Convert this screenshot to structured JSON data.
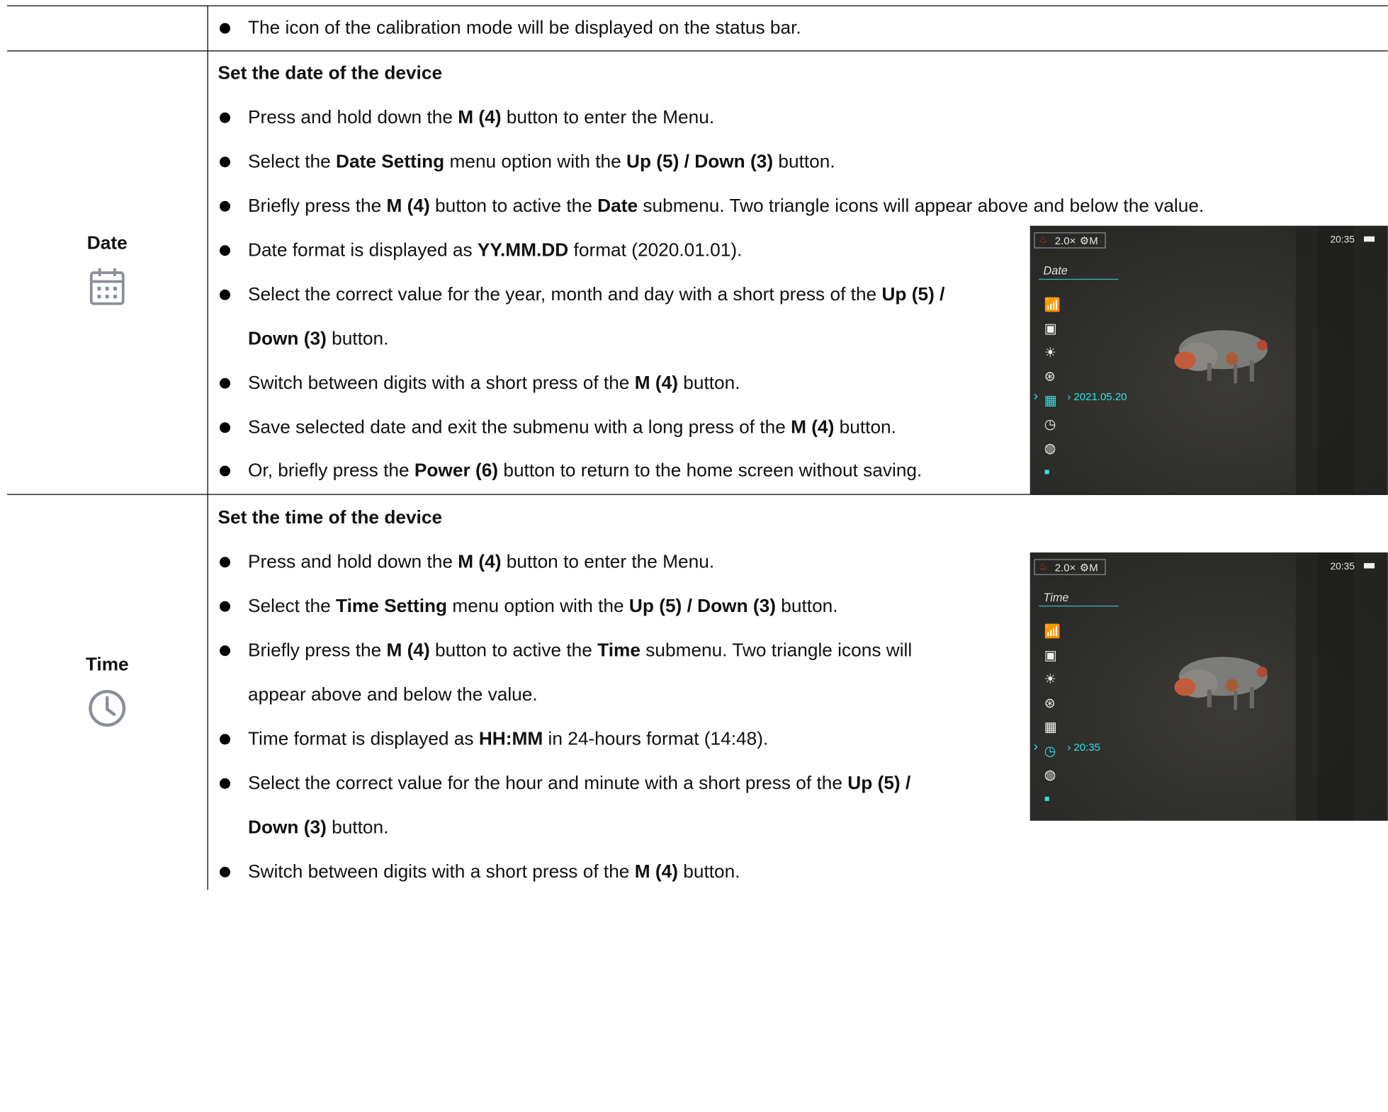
{
  "top_row": {
    "bullets": [
      [
        {
          "t": "The icon of the calibration mode will be displayed on the status bar."
        }
      ]
    ]
  },
  "date_row": {
    "label": "Date",
    "icon": "calendar-icon",
    "heading": "Set the date of the device",
    "bullets": [
      [
        {
          "t": "Press and hold down the "
        },
        {
          "t": "M (4)",
          "b": true
        },
        {
          "t": " button to enter the Menu."
        }
      ],
      [
        {
          "t": "Select the "
        },
        {
          "t": "Date Setting",
          "b": true
        },
        {
          "t": " menu option with the "
        },
        {
          "t": "Up (5) / Down (3)",
          "b": true
        },
        {
          "t": " button."
        }
      ],
      [
        {
          "t": "Briefly press the "
        },
        {
          "t": "M (4)",
          "b": true
        },
        {
          "t": " button to active the "
        },
        {
          "t": "Date",
          "b": true
        },
        {
          "t": " submenu. Two triangle icons will appear above and below the value."
        }
      ],
      [
        {
          "t": "Date format is displayed as "
        },
        {
          "t": "YY.MM.DD",
          "b": true
        },
        {
          "t": " format (2020.01.01)."
        }
      ],
      [
        {
          "t": "Select the correct value for the year, month and day with a short press of the "
        },
        {
          "t": "Up (5) /",
          "b": true
        }
      ],
      [
        {
          "t": "Down (3)",
          "b": true
        },
        {
          "t": " button."
        }
      ],
      [
        {
          "t": "Switch between digits with a short press of the "
        },
        {
          "t": "M (4)",
          "b": true
        },
        {
          "t": " button."
        }
      ],
      [
        {
          "t": "Save selected date and exit the submenu with a long press of the "
        },
        {
          "t": "M (4)",
          "b": true
        },
        {
          "t": " button."
        }
      ],
      [
        {
          "t": "Or, briefly press the "
        },
        {
          "t": "Power (6)",
          "b": true
        },
        {
          "t": " button to return to the home screen without saving."
        }
      ]
    ],
    "screen": {
      "status_zoom": "2.0×",
      "status_mode": "M",
      "clock": "20:35",
      "menu_title": "Date",
      "selected_value": "2021.05.20",
      "accent_color": "#2ee0e6"
    }
  },
  "time_row": {
    "label": "Time",
    "icon": "clock-icon",
    "heading": "Set the time of the device",
    "bullets": [
      [
        {
          "t": "Press and hold down the "
        },
        {
          "t": "M (4)",
          "b": true
        },
        {
          "t": " button to enter the Menu."
        }
      ],
      [
        {
          "t": "Select the "
        },
        {
          "t": "Time Setting",
          "b": true
        },
        {
          "t": " menu option with the "
        },
        {
          "t": "Up (5) / Down (3)",
          "b": true
        },
        {
          "t": " button."
        }
      ],
      [
        {
          "t": "Briefly press the "
        },
        {
          "t": "M (4)",
          "b": true
        },
        {
          "t": " button to active the "
        },
        {
          "t": "Time",
          "b": true
        },
        {
          "t": " submenu. Two triangle icons will"
        }
      ],
      [
        {
          "t": "appear above and below the value."
        }
      ],
      [
        {
          "t": "Time format is displayed as "
        },
        {
          "t": "HH:MM",
          "b": true
        },
        {
          "t": " in 24-hours format (14:48)."
        }
      ],
      [
        {
          "t": "Select the correct value for the hour and minute with a short press of the "
        },
        {
          "t": "Up (5) /",
          "b": true
        }
      ],
      [
        {
          "t": "Down (3)",
          "b": true
        },
        {
          "t": " button."
        }
      ],
      [
        {
          "t": "Switch between digits with a short press of the "
        },
        {
          "t": "M (4)",
          "b": true
        },
        {
          "t": " button."
        }
      ]
    ],
    "screen": {
      "status_zoom": "2.0×",
      "status_mode": "M",
      "clock": "20:35",
      "menu_title": "Time",
      "selected_value": "20:35",
      "accent_color": "#2ee0e6"
    }
  }
}
